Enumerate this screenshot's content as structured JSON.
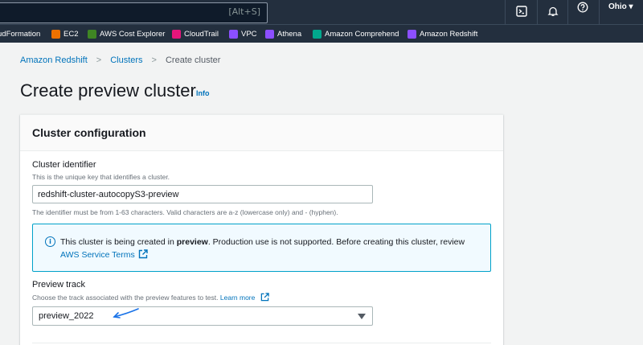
{
  "topnav": {
    "search_shortcut": "[Alt+S]",
    "region": "Ohio ▾",
    "icons": [
      "cloudshell-icon",
      "notifications-bell-icon",
      "help-icon"
    ]
  },
  "favorites": [
    {
      "label": "udFormation",
      "color": "#e7157b"
    },
    {
      "label": "EC2",
      "color": "#ed7100"
    },
    {
      "label": "AWS Cost Explorer",
      "color": "#3f8624"
    },
    {
      "label": "CloudTrail",
      "color": "#e7157b"
    },
    {
      "label": "VPC",
      "color": "#8c4fff"
    },
    {
      "label": "Athena",
      "color": "#8c4fff"
    },
    {
      "label": "Amazon Comprehend",
      "color": "#01a88d"
    },
    {
      "label": "Amazon Redshift",
      "color": "#8c4fff"
    }
  ],
  "breadcrumb": {
    "items": [
      "Amazon Redshift",
      "Clusters",
      "Create cluster"
    ]
  },
  "page": {
    "title": "Create preview cluster",
    "info": "Info"
  },
  "cluster_config": {
    "title": "Cluster configuration",
    "identifier_label": "Cluster identifier",
    "identifier_desc": "This is the unique key that identifies a cluster.",
    "identifier_value": "redshift-cluster-autocopyS3-preview",
    "identifier_constraint": "The identifier must be from 1-63 characters. Valid characters are a-z (lowercase only) and - (hyphen).",
    "alert_pre": "This cluster is being created in ",
    "alert_bold": "preview",
    "alert_post": ". Production use is not supported. Before creating this cluster, review",
    "alert_link": "AWS Service Terms",
    "track_label": "Preview track",
    "track_desc": "Choose the track associated with the preview features to test.",
    "track_learn_more": "Learn more",
    "track_value": "preview_2022"
  },
  "colors": {
    "nav_bg": "#232f3e",
    "link": "#0073bb",
    "alert_border": "#00a1c9"
  }
}
